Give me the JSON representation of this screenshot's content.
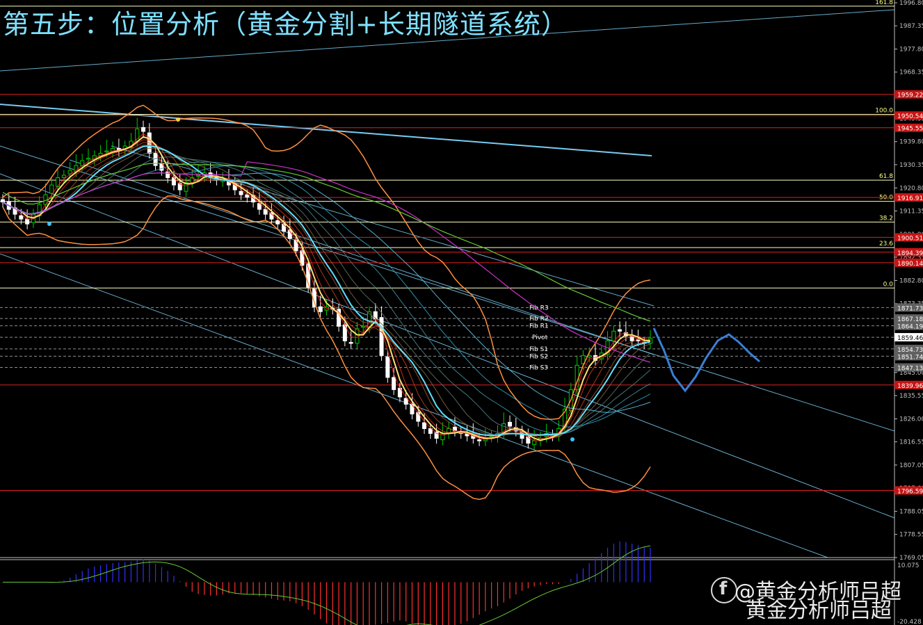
{
  "title": "第五步：位置分析（黄金分割+长期隧道系统）",
  "watermark": {
    "handle": "@黄金分析师吕超",
    "name": "黄金分析师吕超"
  },
  "colors": {
    "background": "#000000",
    "candle_up": "#00cc00",
    "candle_down": "#ffffff",
    "bollinger": "#ff9040",
    "fib_line": "#ffffc0",
    "sr_line": "#e02020",
    "channel": "#7fd8ff",
    "projection": "#3a7fd5",
    "ma_purple": "#cc33cc",
    "ma_green": "#66cc33",
    "macd_up": "#3030ff",
    "macd_down": "#ff3030",
    "macd_neutral": "#ffffff",
    "axis_text": "#c0c0c0"
  },
  "chart_data": {
    "type": "candlestick",
    "title": "",
    "ylim": [
      1769.05,
      1996.8
    ],
    "y_ticks": [
      "1996.80",
      "1987.35",
      "1977.80",
      "1968.35",
      "1958.80",
      "1949.35",
      "1939.80",
      "1930.35",
      "1920.80",
      "1911.35",
      "1901.80",
      "1892.35",
      "1882.80",
      "1873.35",
      "1863.80",
      "1854.35",
      "1845.00",
      "1835.55",
      "1826.00",
      "1816.55",
      "1807.05",
      "1797.60",
      "1788.05",
      "1778.55",
      "1769.05"
    ],
    "close_series": [
      1915,
      1912,
      1910,
      1908,
      1906,
      1910,
      1914,
      1918,
      1922,
      1925,
      1926,
      1928,
      1930,
      1932,
      1933,
      1934,
      1935,
      1936,
      1937,
      1936,
      1938,
      1940,
      1945,
      1944,
      1935,
      1930,
      1928,
      1925,
      1922,
      1920,
      1923,
      1925,
      1926,
      1927,
      1925,
      1924,
      1924,
      1922,
      1920,
      1918,
      1917,
      1915,
      1912,
      1910,
      1908,
      1906,
      1903,
      1900,
      1895,
      1889,
      1880,
      1872,
      1870,
      1872,
      1871,
      1864,
      1858,
      1857,
      1863,
      1864,
      1870,
      1867,
      1852,
      1843,
      1838,
      1835,
      1832,
      1828,
      1825,
      1822,
      1820,
      1818,
      1820,
      1822,
      1821,
      1820,
      1819,
      1818,
      1817,
      1818,
      1819,
      1820,
      1824,
      1823,
      1821,
      1818,
      1816,
      1817,
      1818,
      1820,
      1819,
      1822,
      1830,
      1838,
      1848,
      1852,
      1852,
      1850,
      1853,
      1858,
      1862,
      1862,
      1860,
      1858,
      1858,
      1857,
      1859
    ],
    "fib_levels": [
      {
        "label": "161.8",
        "value": 1995.4
      },
      {
        "label": "100.0",
        "value": 1951.0
      },
      {
        "label": "61.8",
        "value": 1924.0
      },
      {
        "label": "50.0",
        "value": 1915.3
      },
      {
        "label": "38.2",
        "value": 1906.8
      },
      {
        "label": "23.6",
        "value": 1896.3
      },
      {
        "label": "0.0",
        "value": 1879.7
      }
    ],
    "sr_levels": [
      {
        "label": "1959.22",
        "value": 1959.2
      },
      {
        "label": "1950.54",
        "value": 1950.5
      },
      {
        "label": "1945.55",
        "value": 1945.5
      },
      {
        "label": "1916.91",
        "value": 1916.9
      },
      {
        "label": "1900.51",
        "value": 1900.5
      },
      {
        "label": "1894.39",
        "value": 1894.4
      },
      {
        "label": "1890.14",
        "value": 1890.1
      },
      {
        "label": "1839.96",
        "value": 1839.9
      },
      {
        "label": "1796.59",
        "value": 1796.6
      }
    ],
    "pivot_levels": [
      {
        "label": "Fib R3",
        "price": "1871.73",
        "value": 1871.7
      },
      {
        "label": "Fib R2",
        "price": "1867.18",
        "value": 1867.2
      },
      {
        "label": "Fib R1",
        "price": "1864.19",
        "value": 1864.2
      },
      {
        "label": "Pivot",
        "price": "1859.46",
        "value": 1859.5
      },
      {
        "label": "Fib S1",
        "price": "1854.73",
        "value": 1854.7
      },
      {
        "label": "Fib S2",
        "price": "1851.74",
        "value": 1851.7
      },
      {
        "label": "Fib S3",
        "price": "1847.13",
        "value": 1847.1
      }
    ],
    "macd": {
      "ylim": [
        -20.428,
        10.075
      ],
      "top_label": "10.075",
      "bottom_label": "-20.428"
    }
  }
}
